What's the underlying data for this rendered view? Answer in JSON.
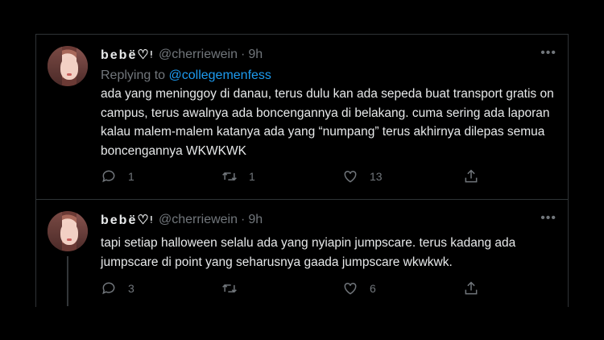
{
  "tweets": [
    {
      "name": "bebë♡ᵎ",
      "handle": "@cherriewein",
      "time": "9h",
      "replying_label": "Replying to",
      "replying_to": "@collegemenfess",
      "text": "ada yang meninggoy di danau, terus dulu kan ada sepeda buat transport gratis on campus, terus awalnya ada boncengannya di belakang. cuma sering ada laporan kalau malem-malem katanya ada yang “numpang” terus akhirnya dilepas semua boncengannya WKWKWK",
      "replies": "1",
      "retweets": "1",
      "likes": "13"
    },
    {
      "name": "bebë♡ᵎ",
      "handle": "@cherriewein",
      "time": "9h",
      "text": "tapi setiap halloween selalu ada yang nyiapin jumpscare. terus kadang ada jumpscare di point yang seharusnya gaada jumpscare wkwkwk.",
      "replies": "3",
      "retweets": "",
      "likes": "6"
    }
  ],
  "icons": {
    "reply": "reply-icon",
    "retweet": "retweet-icon",
    "like": "heart-icon",
    "share": "share-icon",
    "more": "more-icon"
  }
}
